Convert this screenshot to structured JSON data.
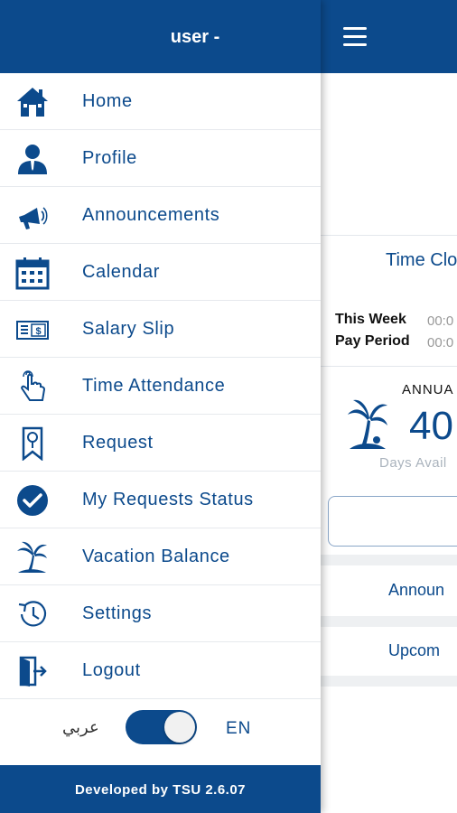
{
  "drawer": {
    "user_title": "user -",
    "menu": [
      {
        "label": "Home",
        "icon": "home-icon"
      },
      {
        "label": "Profile",
        "icon": "profile-icon"
      },
      {
        "label": "Announcements",
        "icon": "megaphone-icon"
      },
      {
        "label": "Calendar",
        "icon": "calendar-icon"
      },
      {
        "label": "Salary Slip",
        "icon": "salary-slip-icon"
      },
      {
        "label": "Time Attendance",
        "icon": "touch-hand-icon"
      },
      {
        "label": "Request",
        "icon": "request-bookmark-icon"
      },
      {
        "label": "My Requests Status",
        "icon": "checkmark-circle-icon"
      },
      {
        "label": "Vacation Balance",
        "icon": "palm-tree-icon"
      },
      {
        "label": "Settings",
        "icon": "history-clock-icon"
      },
      {
        "label": "Logout",
        "icon": "logout-door-icon"
      }
    ],
    "language": {
      "arabic_label": "عربي",
      "english_label": "EN",
      "selected": "EN"
    },
    "footer": "Developed by TSU 2.6.07"
  },
  "main": {
    "time_clock_title": "Time Clo",
    "this_week_label": "This Week",
    "this_week_value": "00:0",
    "pay_period_label": "Pay Period",
    "pay_period_value": "00:0",
    "annual_label": "ANNUA",
    "annual_value": "40",
    "days_available": "Days Avail",
    "announcements_link": "Announ",
    "upcoming_link": "Upcom"
  },
  "colors": {
    "primary": "#0c4a8c",
    "background": "#ffffff",
    "separator": "#eef0f2"
  }
}
